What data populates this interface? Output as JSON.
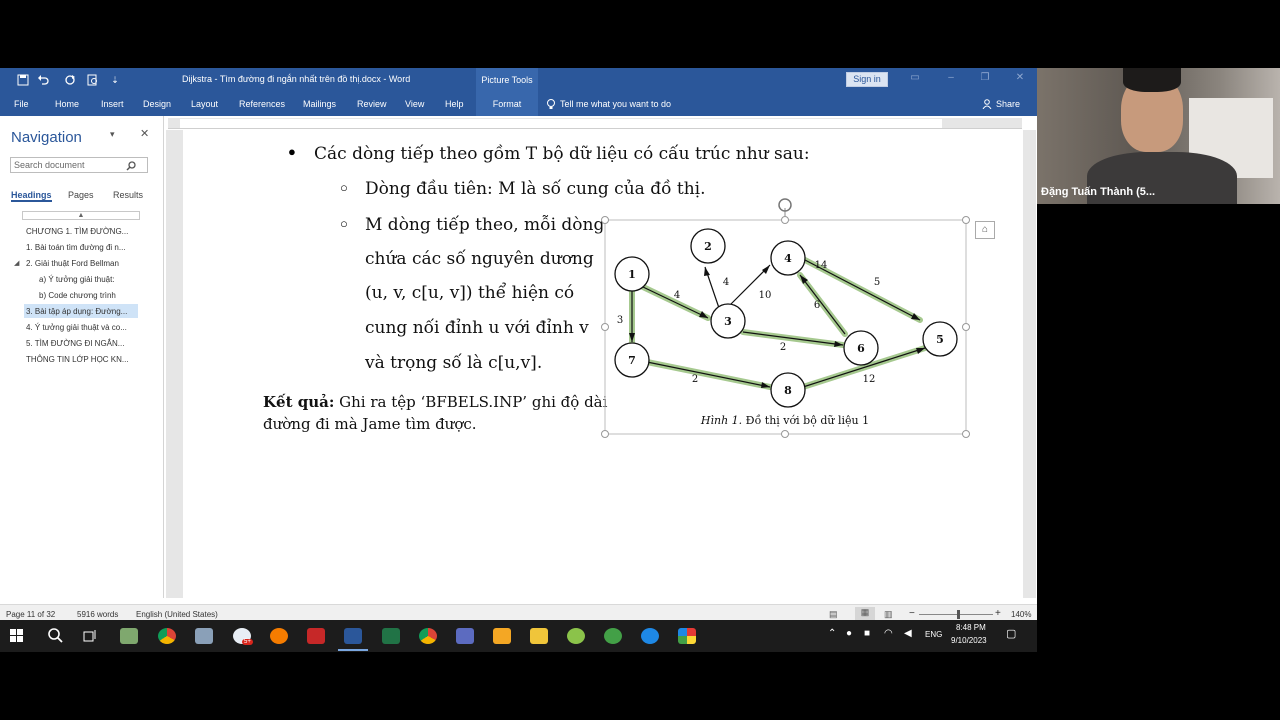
{
  "window": {
    "doc_title": "Dijkstra - Tìm đường đi ngắn nhất trên đồ thị.docx - Word",
    "picture_tools": "Picture Tools",
    "sign_in": "Sign in"
  },
  "menu": {
    "file": "File",
    "home": "Home",
    "insert": "Insert",
    "design": "Design",
    "layout": "Layout",
    "references": "References",
    "mailings": "Mailings",
    "review": "Review",
    "view": "View",
    "help": "Help",
    "format": "Format",
    "tell_me": "Tell me what you want to do",
    "share": "Share"
  },
  "nav": {
    "title": "Navigation",
    "search_placeholder": "Search document",
    "tabs": {
      "headings": "Headings",
      "pages": "Pages",
      "results": "Results"
    },
    "items": [
      "CHƯƠNG 1. TÌM ĐƯỜNG...",
      "1. Bài toán tìm đường đi n...",
      "2. Giải thuật Ford Bellman",
      "a) Ý tưởng giải thuật:",
      "b) Code chương trình",
      "3. Bài tập áp dụng: Đường...",
      "4. Ý tưởng giải thuật và co...",
      "5. TÌM ĐƯỜNG ĐI NGẮN...",
      "THÔNG TIN LỚP HỌC KN..."
    ]
  },
  "document": {
    "line1": "Các dòng tiếp theo gồm T bộ dữ liệu có cấu trúc như sau:",
    "line2": "Dòng đầu tiên: M là số cung của đồ thị.",
    "para_lines": [
      "M dòng tiếp theo, mỗi dòng",
      "chứa các số nguyên dương",
      "(u, v, c[u, v])   thể  hiện  có",
      "cung nối đỉnh u với đỉnh v",
      "và trọng số là c[u,v]."
    ],
    "ket_qua_label": "Kết quả:",
    "ket_qua_text": " Ghi ra tệp ‘BFBELS.INP’ ghi độ dài",
    "ket_qua_line2": "đường đi mà Jame tìm được.",
    "caption_italic": "Hình 1.",
    "caption_rest": " Đồ thị với bộ dữ liệu 1",
    "nodes": [
      "1",
      "2",
      "3",
      "4",
      "5",
      "6",
      "7",
      "8"
    ],
    "weights": [
      "4",
      "3",
      "4",
      "10",
      "5",
      "6",
      "2",
      "2",
      "12",
      "14"
    ]
  },
  "status": {
    "page": "Page 11 of 32",
    "words": "5916 words",
    "language": "English (United States)",
    "zoom": "140%"
  },
  "taskbar": {
    "time": "8:48 PM",
    "date": "9/10/2023",
    "lang": "ENG",
    "badge": "5+"
  },
  "webcam": {
    "name": "Đặng Tuấn Thành (5..."
  },
  "colors": {
    "word_blue": "#2b579a",
    "highlight_edge": "#a6c98f"
  }
}
